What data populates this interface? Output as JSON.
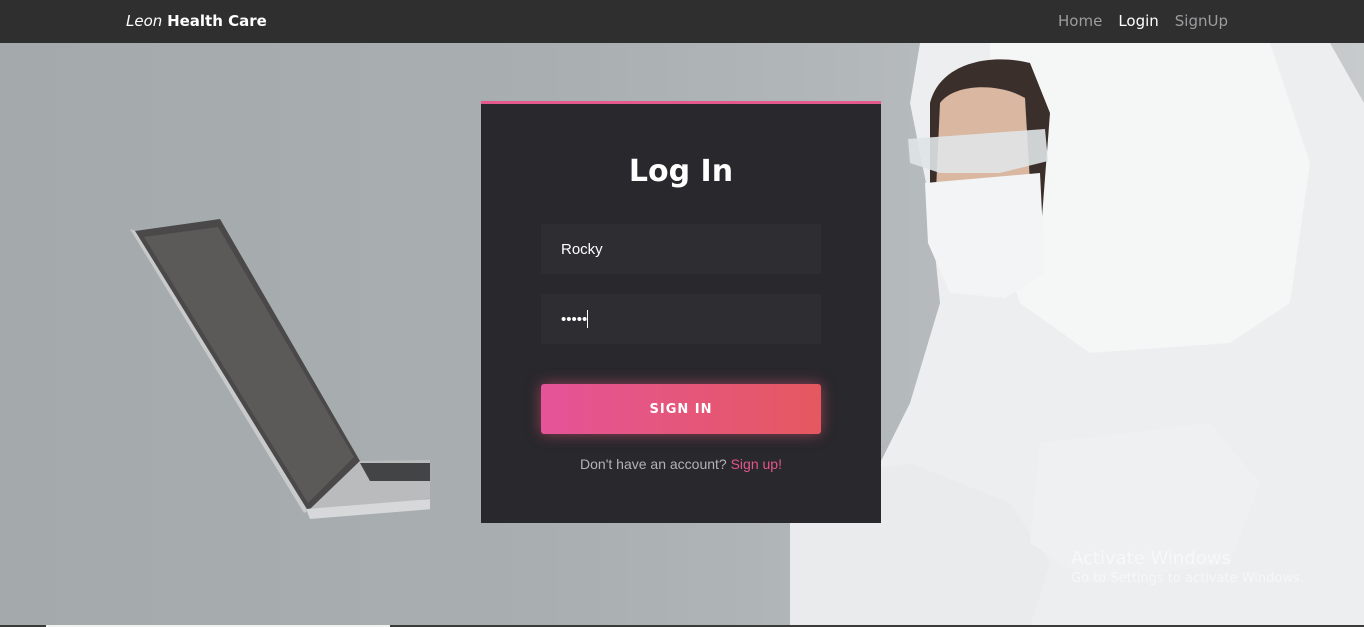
{
  "navbar": {
    "brand_italic": "Leon",
    "brand_bold": "Health Care",
    "links": [
      {
        "label": "Home",
        "active": false
      },
      {
        "label": "Login",
        "active": true
      },
      {
        "label": "SignUp",
        "active": false
      }
    ]
  },
  "login": {
    "title": "Log In",
    "username_value": "Rocky",
    "password_value": "•••••",
    "submit_label": "SIGN IN",
    "signup_prompt": "Don't have an account?",
    "signup_link": "Sign up!"
  },
  "watermark": {
    "title": "Activate Windows",
    "subtitle": "Go to Settings to activate Windows."
  },
  "colors": {
    "accent": "#e5558f",
    "navbar_bg": "#2f2f30",
    "card_bg": "#29282c"
  }
}
